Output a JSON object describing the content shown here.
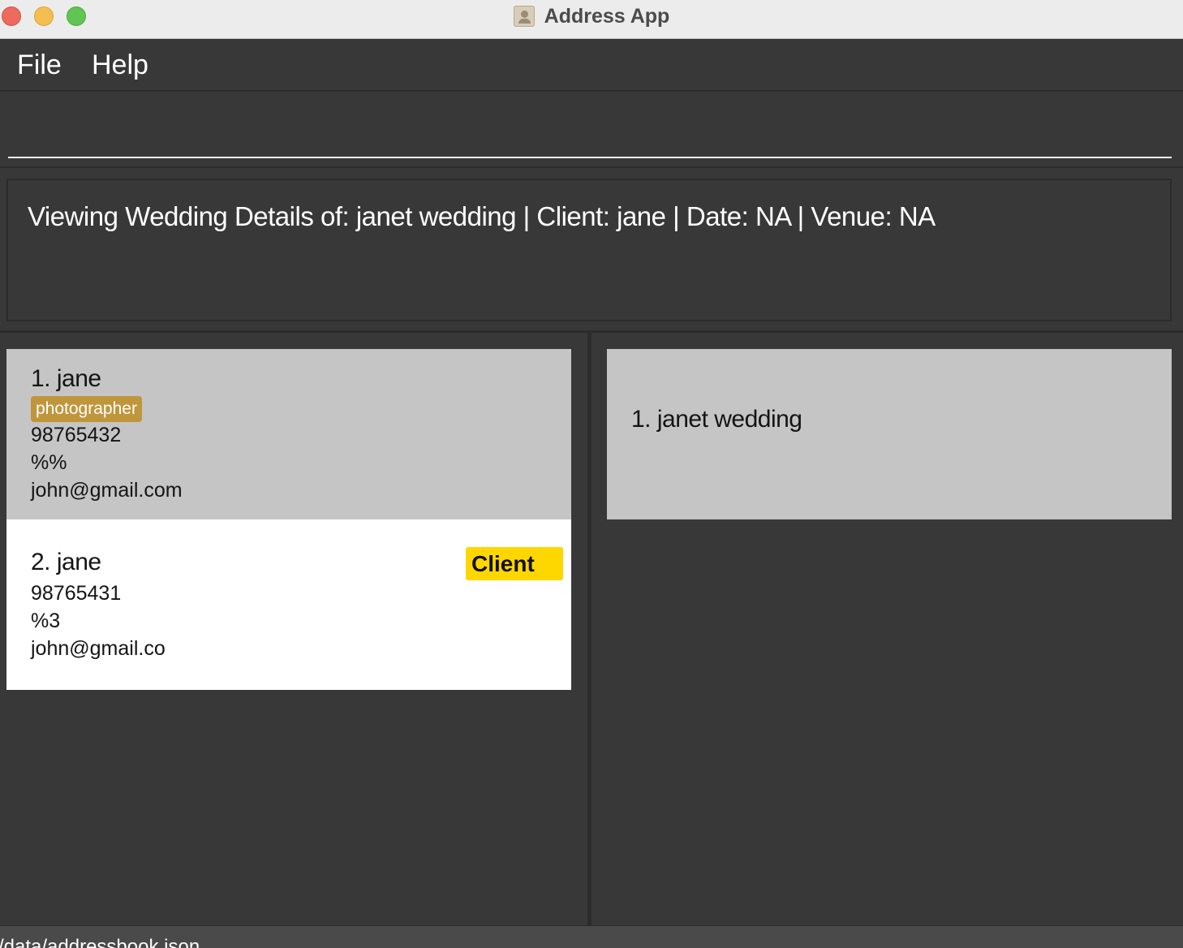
{
  "window": {
    "title": "Address App",
    "app_icon": "address-book-icon"
  },
  "menu": {
    "file": "File",
    "help": "Help"
  },
  "command": {
    "value": "",
    "placeholder": ""
  },
  "result": {
    "text": "Viewing Wedding Details of: janet wedding | Client: jane | Date: NA | Venue: NA"
  },
  "persons": [
    {
      "name": "1. jane",
      "tag": "photographer",
      "phone": "98765432",
      "address": "%%",
      "email": "john@gmail.com",
      "selected": true
    },
    {
      "name": "2. jane",
      "role_badge": "Client",
      "phone": "98765431",
      "address": "%3",
      "email": "john@gmail.co",
      "selected": false
    }
  ],
  "weddings": [
    {
      "name": "1. janet wedding"
    }
  ],
  "status": {
    "path": "/data/addressbook.json"
  },
  "colors": {
    "background": "#383838",
    "card_selected": "#c5c5c5",
    "card_default": "#ffffff",
    "tag_photographer": "#c0963c",
    "badge_client": "#ffd700"
  }
}
